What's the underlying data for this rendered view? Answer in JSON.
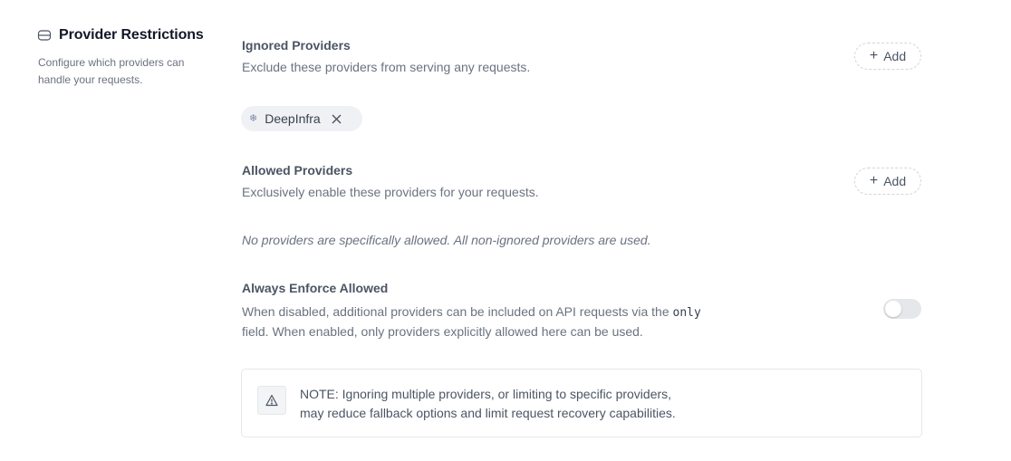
{
  "section": {
    "title": "Provider Restrictions",
    "description": "Configure which providers can handle your requests."
  },
  "ignored": {
    "title": "Ignored Providers",
    "description": "Exclude these providers from serving any requests.",
    "add_label": "Add",
    "chips": [
      {
        "label": "DeepInfra",
        "icon": "snowflake-icon"
      }
    ]
  },
  "allowed": {
    "title": "Allowed Providers",
    "description": "Exclusively enable these providers for your requests.",
    "add_label": "Add",
    "empty_message": "No providers are specifically allowed. All non-ignored providers are used."
  },
  "enforce": {
    "title": "Always Enforce Allowed",
    "description_before": "When disabled, additional providers can be included on API requests via the",
    "code": "only",
    "description_after": "field. When enabled, only providers explicitly allowed here can be used.",
    "enabled": false
  },
  "note": {
    "icon": "warning-icon",
    "text": "NOTE: Ignoring multiple providers, or limiting to specific providers, may reduce fallback options and limit request recovery capabilities."
  },
  "colors": {
    "toggle_off": "#e5e7eb",
    "chip_bg": "#f0f1f4"
  }
}
